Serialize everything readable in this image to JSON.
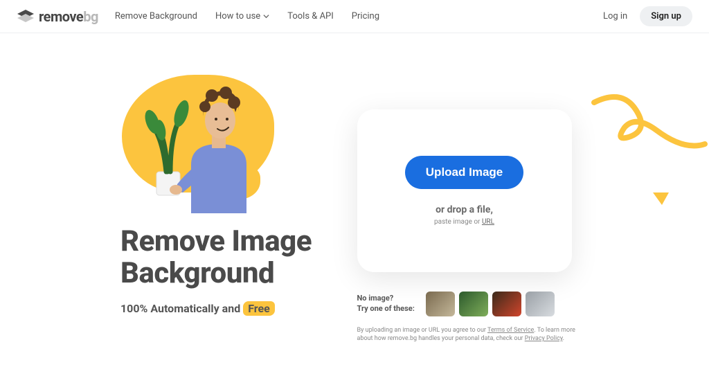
{
  "brand": {
    "name_main": "remove",
    "name_suffix": "bg"
  },
  "nav": {
    "remove_bg": "Remove Background",
    "how_to_use": "How to use",
    "tools_api": "Tools & API",
    "pricing": "Pricing"
  },
  "auth": {
    "login": "Log in",
    "signup": "Sign up"
  },
  "hero": {
    "headline_line1": "Remove Image",
    "headline_line2": "Background",
    "subhead_prefix": "100% Automatically and",
    "subhead_free": "Free"
  },
  "upload": {
    "button": "Upload Image",
    "drop": "or drop a file,",
    "paste_prefix": "paste image or ",
    "paste_url": "URL"
  },
  "samples": {
    "no_image": "No image?",
    "try_one": "Try one of these:"
  },
  "legal": {
    "line1_prefix": "By uploading an image or URL you agree to our ",
    "tos": "Terms of Service",
    "line1_suffix": ". To learn more about how remove.bg handles your personal data, check our ",
    "privacy": "Privacy Policy",
    "tail": "."
  },
  "colors": {
    "accent_yellow": "#fcc43e",
    "accent_blue": "#1a6ee0"
  }
}
